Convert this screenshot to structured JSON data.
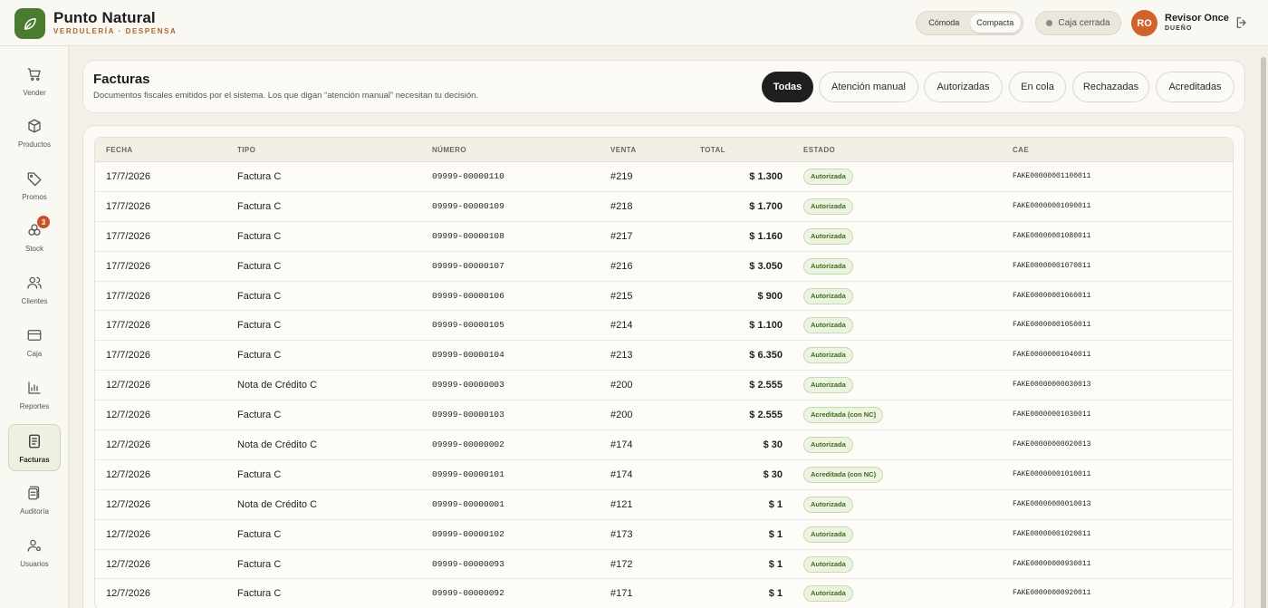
{
  "brand": {
    "name": "Punto Natural",
    "subtitle": "VERDULERÍA · DESPENSA"
  },
  "header": {
    "density": [
      "Cómoda",
      "Compacta"
    ],
    "density_selected": "Compacta",
    "caja_status": "Caja cerrada",
    "user": {
      "initials": "RO",
      "name": "Revisor Once",
      "role": "DUEÑO"
    }
  },
  "sidebar": {
    "items": [
      {
        "label": "Vender",
        "icon": "cart-icon"
      },
      {
        "label": "Productos",
        "icon": "box-icon"
      },
      {
        "label": "Promos",
        "icon": "tag-icon"
      },
      {
        "label": "Stock",
        "icon": "stock-icon",
        "badge": "3"
      },
      {
        "label": "Clientes",
        "icon": "users-icon"
      },
      {
        "label": "Caja",
        "icon": "card-icon"
      },
      {
        "label": "Reportes",
        "icon": "chart-icon"
      },
      {
        "label": "Facturas",
        "icon": "invoice-icon",
        "active": true
      },
      {
        "label": "Auditoría",
        "icon": "audit-icon"
      },
      {
        "label": "Usuarios",
        "icon": "user-settings-icon"
      }
    ]
  },
  "page": {
    "title": "Facturas",
    "description": "Documentos fiscales emitidos por el sistema. Los que digan “atención manual” necesitan tu decisión.",
    "filters": [
      "Todas",
      "Atención manual",
      "Autorizadas",
      "En cola",
      "Rechazadas",
      "Acreditadas"
    ],
    "filter_selected": "Todas"
  },
  "table": {
    "columns": [
      "FECHA",
      "TIPO",
      "NÚMERO",
      "VENTA",
      "TOTAL",
      "ESTADO",
      "CAE"
    ],
    "rows": [
      {
        "fecha": "17/7/2026",
        "tipo": "Factura C",
        "numero": "09999-00000110",
        "venta": "#219",
        "total": "$ 1.300",
        "estado": "Autorizada",
        "cae": "FAKE00000001100011"
      },
      {
        "fecha": "17/7/2026",
        "tipo": "Factura C",
        "numero": "09999-00000109",
        "venta": "#218",
        "total": "$ 1.700",
        "estado": "Autorizada",
        "cae": "FAKE00000001090011"
      },
      {
        "fecha": "17/7/2026",
        "tipo": "Factura C",
        "numero": "09999-00000108",
        "venta": "#217",
        "total": "$ 1.160",
        "estado": "Autorizada",
        "cae": "FAKE00000001080011"
      },
      {
        "fecha": "17/7/2026",
        "tipo": "Factura C",
        "numero": "09999-00000107",
        "venta": "#216",
        "total": "$ 3.050",
        "estado": "Autorizada",
        "cae": "FAKE00000001070011"
      },
      {
        "fecha": "17/7/2026",
        "tipo": "Factura C",
        "numero": "09999-00000106",
        "venta": "#215",
        "total": "$ 900",
        "estado": "Autorizada",
        "cae": "FAKE00000001060011"
      },
      {
        "fecha": "17/7/2026",
        "tipo": "Factura C",
        "numero": "09999-00000105",
        "venta": "#214",
        "total": "$ 1.100",
        "estado": "Autorizada",
        "cae": "FAKE00000001050011"
      },
      {
        "fecha": "17/7/2026",
        "tipo": "Factura C",
        "numero": "09999-00000104",
        "venta": "#213",
        "total": "$ 6.350",
        "estado": "Autorizada",
        "cae": "FAKE00000001040011"
      },
      {
        "fecha": "12/7/2026",
        "tipo": "Nota de Crédito C",
        "numero": "09999-00000003",
        "venta": "#200",
        "total": "$ 2.555",
        "estado": "Autorizada",
        "cae": "FAKE00000000030013"
      },
      {
        "fecha": "12/7/2026",
        "tipo": "Factura C",
        "numero": "09999-00000103",
        "venta": "#200",
        "total": "$ 2.555",
        "estado": "Acreditada (con NC)",
        "cae": "FAKE00000001030011"
      },
      {
        "fecha": "12/7/2026",
        "tipo": "Nota de Crédito C",
        "numero": "09999-00000002",
        "venta": "#174",
        "total": "$ 30",
        "estado": "Autorizada",
        "cae": "FAKE00000000020013"
      },
      {
        "fecha": "12/7/2026",
        "tipo": "Factura C",
        "numero": "09999-00000101",
        "venta": "#174",
        "total": "$ 30",
        "estado": "Acreditada (con NC)",
        "cae": "FAKE00000001010011"
      },
      {
        "fecha": "12/7/2026",
        "tipo": "Nota de Crédito C",
        "numero": "09999-00000001",
        "venta": "#121",
        "total": "$ 1",
        "estado": "Autorizada",
        "cae": "FAKE00000000010013"
      },
      {
        "fecha": "12/7/2026",
        "tipo": "Factura C",
        "numero": "09999-00000102",
        "venta": "#173",
        "total": "$ 1",
        "estado": "Autorizada",
        "cae": "FAKE00000001020011"
      },
      {
        "fecha": "12/7/2026",
        "tipo": "Factura C",
        "numero": "09999-00000093",
        "venta": "#172",
        "total": "$ 1",
        "estado": "Autorizada",
        "cae": "FAKE00000000930011"
      },
      {
        "fecha": "12/7/2026",
        "tipo": "Factura C",
        "numero": "09999-00000092",
        "venta": "#171",
        "total": "$ 1",
        "estado": "Autorizada",
        "cae": "FAKE00000000920011"
      }
    ]
  },
  "colors": {
    "brand_green": "#4b7b2e",
    "accent_orange": "#d2622b",
    "status_green": "#3f6b1d"
  }
}
